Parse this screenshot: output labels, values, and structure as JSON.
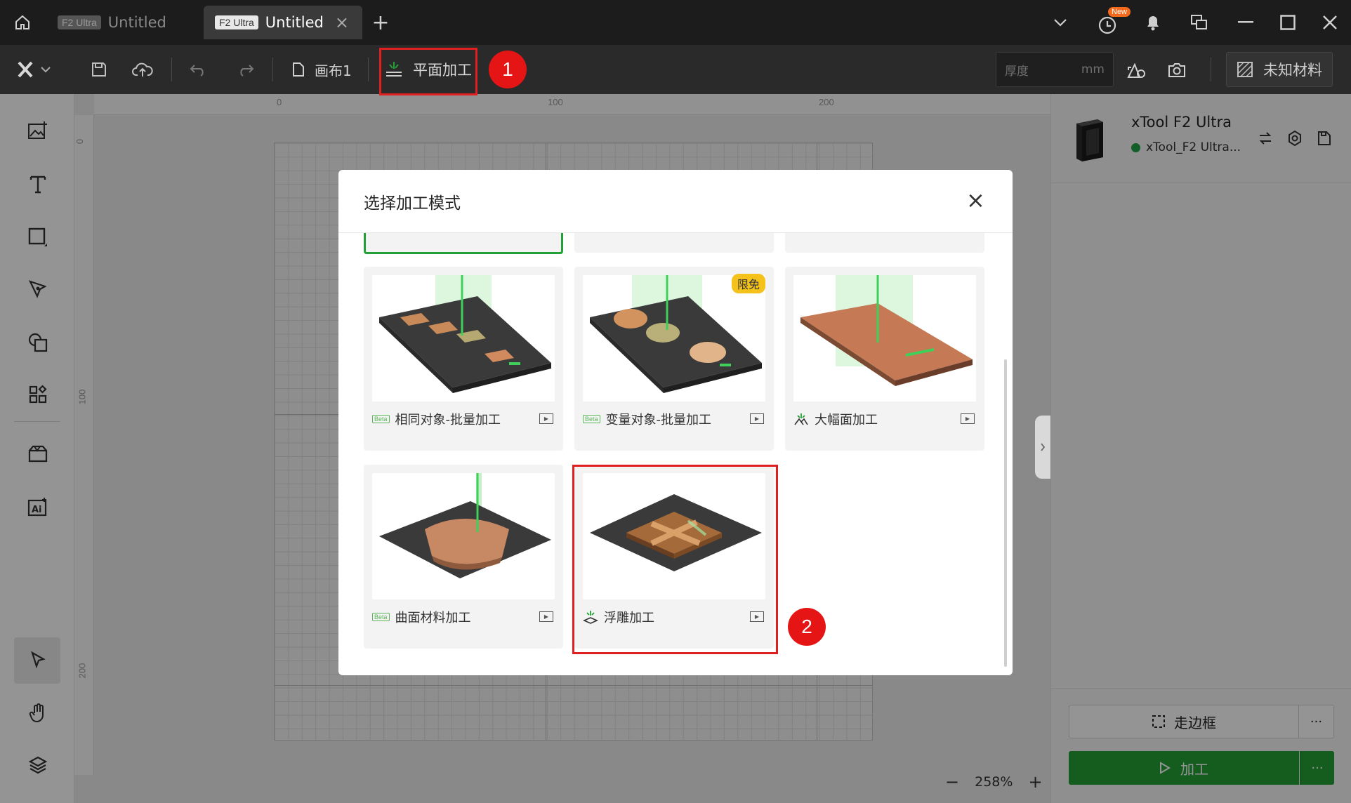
{
  "titlebar": {
    "tabs": [
      {
        "badge": "F2 Ultra",
        "title": "Untitled"
      },
      {
        "badge": "F2 Ultra",
        "title": "Untitled",
        "close": "×"
      }
    ],
    "add_tab": "+",
    "new_badge": "New"
  },
  "toolbar": {
    "canvas_name": "画布1",
    "process_mode": "平面加工",
    "thickness_placeholder": "厚度",
    "thickness_unit": "mm",
    "material": "未知材料"
  },
  "ruler": {
    "h_ticks": [
      "0",
      "100",
      "200"
    ],
    "v_ticks": [
      "0",
      "100",
      "200"
    ]
  },
  "device": {
    "name": "xTool F2 Ultra",
    "connection": "xTool_F2 Ultra...",
    "status_color": "#1fa345"
  },
  "actions": {
    "frame": "走边框",
    "process": "加工",
    "more": "···"
  },
  "zoom": {
    "level": "258%",
    "minus": "−",
    "plus": "+"
  },
  "modal": {
    "title": "选择加工模式",
    "close": "×",
    "free_badge": "限免",
    "cards": [
      {
        "label": "相同对象-批量加工",
        "beta": "Beta"
      },
      {
        "label": "变量对象-批量加工",
        "beta": "Beta"
      },
      {
        "label": "大幅面加工"
      },
      {
        "label": "曲面材料加工",
        "beta": "Beta"
      },
      {
        "label": "浮雕加工"
      }
    ]
  },
  "annotations": {
    "step1": "1",
    "step2": "2"
  },
  "colors": {
    "accent_green": "#23a036",
    "annotation_red": "#e51515"
  }
}
